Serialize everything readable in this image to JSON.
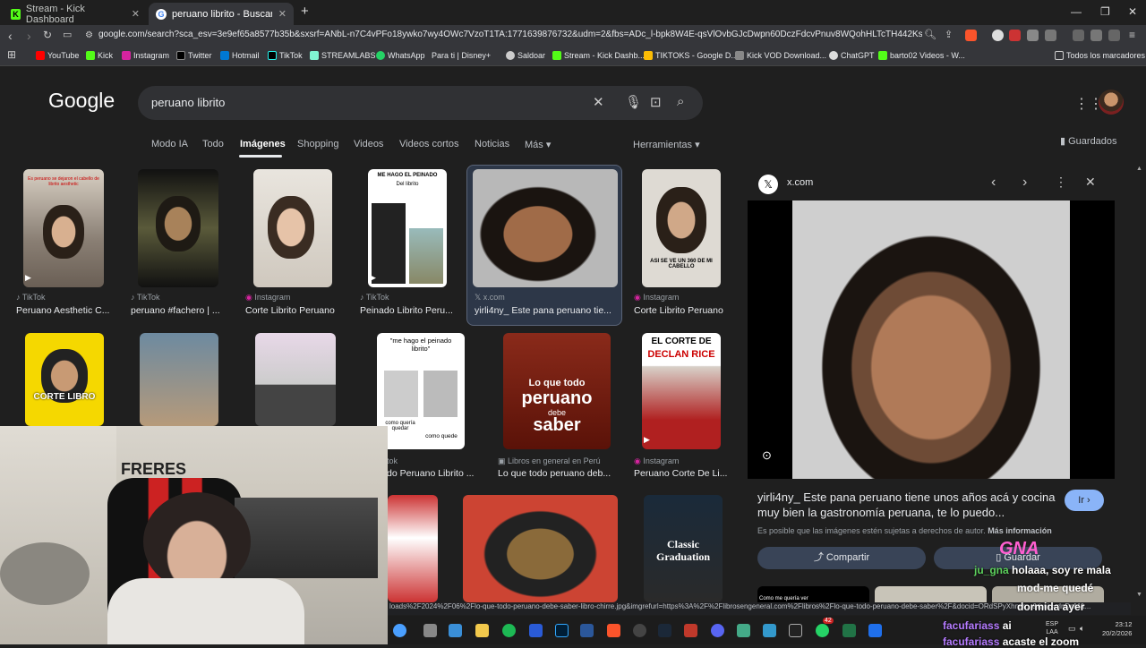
{
  "tabs": [
    {
      "title": "Stream - Kick Dashboard",
      "active": false
    },
    {
      "title": "peruano librito - Buscar con Goo",
      "active": true
    }
  ],
  "url": "google.com/search?sca_esv=3e9ef65a8577b35b&sxsrf=ANbL-n7C4vPFo18ywko7wy4OWc7VzoT1TA:1771639876732&udm=2&fbs=ADc_l-bpk8W4E-qsVlOvbGJcDwpn60DczFdcvPnuv8WQohHLTcTH442KskDyC74HpRHrY...",
  "bookmarks": [
    "YouTube",
    "Kick",
    "Instagram",
    "Twitter",
    "Hotmail",
    "TikTok",
    "STREAMLABS",
    "WhatsApp",
    "Para ti | Disney+",
    "Saldoar",
    "Stream - Kick Dashb...",
    "TIKTOKS - Google D...",
    "Kick VOD Download...",
    "ChatGPT",
    "barto02 Videos - W...",
    "Todos los marcadores"
  ],
  "google": {
    "logo": "Google",
    "query": "peruano librito"
  },
  "search_tabs": [
    "Modo IA",
    "Todo",
    "Imágenes",
    "Shopping",
    "Videos",
    "Videos cortos",
    "Noticias",
    "Más ▾",
    "Herramientas ▾"
  ],
  "guardados": "Guardados",
  "results_row1": [
    {
      "source": "TikTok",
      "title": "Peruano Aesthetic C..."
    },
    {
      "source": "TikTok",
      "title": "peruano #fachero | ..."
    },
    {
      "source": "Instagram",
      "title": "Corte Librito Peruano"
    },
    {
      "source": "TikTok",
      "title": "Peinado Librito Peru..."
    },
    {
      "source": "x.com",
      "title": "yirli4ny_ Este pana peruano tie..."
    },
    {
      "source": "Instagram",
      "title": "Corte Librito Peruano"
    }
  ],
  "results_row2": [
    {
      "source": "tok",
      "title": "do Peruano Librito ..."
    },
    {
      "source": "Libros en general en Perú",
      "title": "Lo que todo peruano deb..."
    },
    {
      "source": "Instagram",
      "title": "Peruano Corte De Li..."
    }
  ],
  "thumb_texts": {
    "t1": "Es peruano se dejaron el cabello de librito aesthetic",
    "t4a": "ME HAGO EL PEINADO",
    "t4b": "Del librito",
    "t6": "ASI SE VE UN 360 DE MI CABELLO",
    "r2t1": "CORTE LIBRO",
    "r2t4": "\"me hago el peinado librito\"",
    "r2t4b": "como quería quedar",
    "r2t4c": "como quede",
    "r2t5a": "Lo que todo",
    "r2t5b": "peruano",
    "r2t5c": "debe",
    "r2t5d": "saber",
    "r2t6a": "EL CORTE DE",
    "r2t6b": "DECLAN RICE",
    "r3t4a": "Classic",
    "r3t4b": "Graduation"
  },
  "panel": {
    "source": "x.com",
    "title": "yirli4ny_ Este pana peruano tiene unos años acá y cocina muy bien la gastronomía peruana, te lo puedo...",
    "go": "Ir ›",
    "copyright": "Es posible que las imágenes estén sujetas a derechos de autor.",
    "more_info": "Más información",
    "share": "Compartir",
    "save": "Guardar",
    "related": "Como me quería ver"
  },
  "webcam_text": "FRERES",
  "chat": [
    {
      "user": "ju_gna",
      "msg": "holaaa, soy re mala"
    },
    {
      "user": "",
      "msg": "mod-me quedé"
    },
    {
      "user": "",
      "msg": "dormida ayer"
    },
    {
      "user": "facufariass",
      "msg": "ai"
    },
    {
      "user": "facufariass",
      "msg": "acaste el zoom"
    }
  ],
  "status_url": "loads%2F2024%2F06%2Flo-que-todo-peruano-debe-saber-libro-chirre.jpg&imgrefurl=https%3A%2F%2Flibrosengeneral.com%2Flibros%2Flo-que-todo-peruano-debe-saber%2F&docid=ORdSPyXhnsn...&tbnid=dnDnM&...",
  "taskbar": {
    "lang": "ESP",
    "lang2": "LAA",
    "time": "23:12",
    "date": "20/2/2026",
    "badge": "42"
  },
  "colors": {
    "accent": "#8ab4f8",
    "bg": "#1f1f1f",
    "kick": "#53fc18"
  }
}
